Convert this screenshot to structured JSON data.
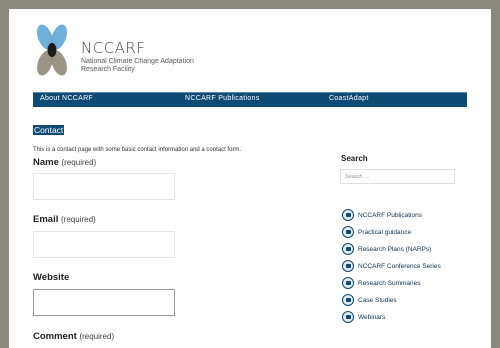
{
  "logo": {
    "brand": "NCCARF",
    "subtitle": "National Climate Change Adaptation Research Facility",
    "colors": {
      "blue": "#5fa7d6",
      "taupe": "#8f8878",
      "dark": "#1b1b1b"
    }
  },
  "nav": {
    "items": [
      {
        "label": "About NCCARF"
      },
      {
        "label": "NCCARF Publications"
      },
      {
        "label": "CoastAdapt"
      }
    ]
  },
  "main": {
    "title": "Contact",
    "intro": "This is a contact page with some basic contact information and a contact form.",
    "fields": [
      {
        "label": "Name",
        "required": "(required)"
      },
      {
        "label": "Email",
        "required": "(required)"
      },
      {
        "label": "Website",
        "required": ""
      },
      {
        "label": "Comment",
        "required": "(required)"
      }
    ]
  },
  "sidebar": {
    "search_title": "Search",
    "search_placeholder": "Search …",
    "links": [
      {
        "label": "NCCARF Publications",
        "icon": "book-icon"
      },
      {
        "label": "Practical guidance",
        "icon": "guidance-icon"
      },
      {
        "label": "Research Plans (NARPs)",
        "icon": "plan-icon"
      },
      {
        "label": "NCCARF Conference Series",
        "icon": "conference-icon"
      },
      {
        "label": "Research Summaries",
        "icon": "magnifier-icon"
      },
      {
        "label": "Case Studies",
        "icon": "briefcase-icon"
      },
      {
        "label": "Webinars",
        "icon": "screen-icon"
      }
    ]
  },
  "theme": {
    "nav_bg": "#0d4a74",
    "frame_bg": "#8a877d"
  }
}
